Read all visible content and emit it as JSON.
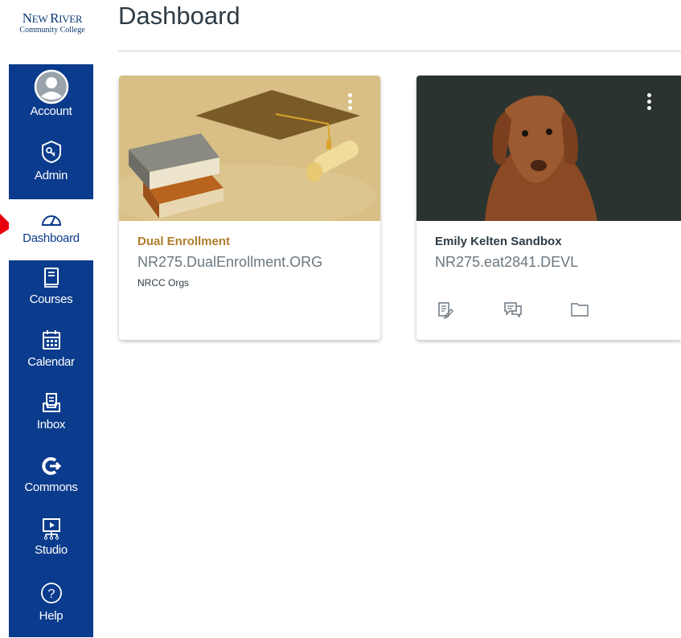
{
  "logo": {
    "line1_big_n": "N",
    "line1_ew": "EW ",
    "line1_big_r": "R",
    "line1_iver": "IVER",
    "line2": "Community College"
  },
  "nav": {
    "account": "Account",
    "admin": "Admin",
    "dashboard": "Dashboard",
    "courses": "Courses",
    "calendar": "Calendar",
    "inbox": "Inbox",
    "commons": "Commons",
    "studio": "Studio",
    "help": "Help"
  },
  "page": {
    "title": "Dashboard"
  },
  "cards": [
    {
      "name": "Dual Enrollment",
      "code": "NR275.DualEnrollment.ORG",
      "term": "NRCC Orgs",
      "name_color": "#b07d2b"
    },
    {
      "name": "Emily Kelten Sandbox",
      "code": "NR275.eat2841.DEVL",
      "term": "",
      "name_color": "#2d3b45"
    }
  ],
  "colors": {
    "nav_bg": "#0b3b8c",
    "accent": "#b07d2b",
    "arrow": "#e8000b"
  },
  "icons": {
    "card2": [
      "assignments-icon",
      "discussions-icon",
      "files-icon"
    ]
  }
}
